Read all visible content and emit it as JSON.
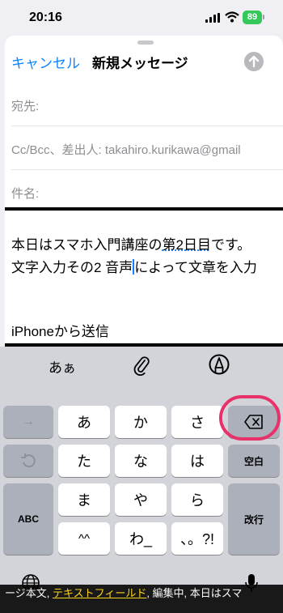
{
  "status_bar": {
    "time": "20:16",
    "battery": "89"
  },
  "compose": {
    "cancel_label": "キャンセル",
    "title": "新規メッセージ",
    "to_label": "宛先:",
    "cc_label": "Cc/Bcc、差出人: takahiro.kurikawa@gmail",
    "subject_label": "件名:"
  },
  "body": {
    "line1_a": "本日はスマホ入門講座の",
    "line1_b": "第2日目",
    "line1_c": "です。",
    "line2_a": "文字入力その2 音声",
    "line2_b": "によって文章を入力",
    "signature": "iPhoneから送信"
  },
  "keyboard": {
    "mode_label": "あぁ",
    "row1": [
      "→",
      "あ",
      "か",
      "さ"
    ],
    "row2": [
      "た",
      "な",
      "は"
    ],
    "row3": [
      "ま",
      "や",
      "ら"
    ],
    "row4": [
      "^^",
      "わ_",
      "、。?!"
    ],
    "space_label": "空白",
    "abc_label": "ABC",
    "return_label": "改行"
  },
  "caption": {
    "part1": "ージ本文, ",
    "highlight": "テキストフィールド",
    "part2": ", 編集中, 本日はスマ"
  },
  "colors": {
    "accent": "#0a84ff",
    "annotation": "#e8306a",
    "battery": "#34c759"
  }
}
